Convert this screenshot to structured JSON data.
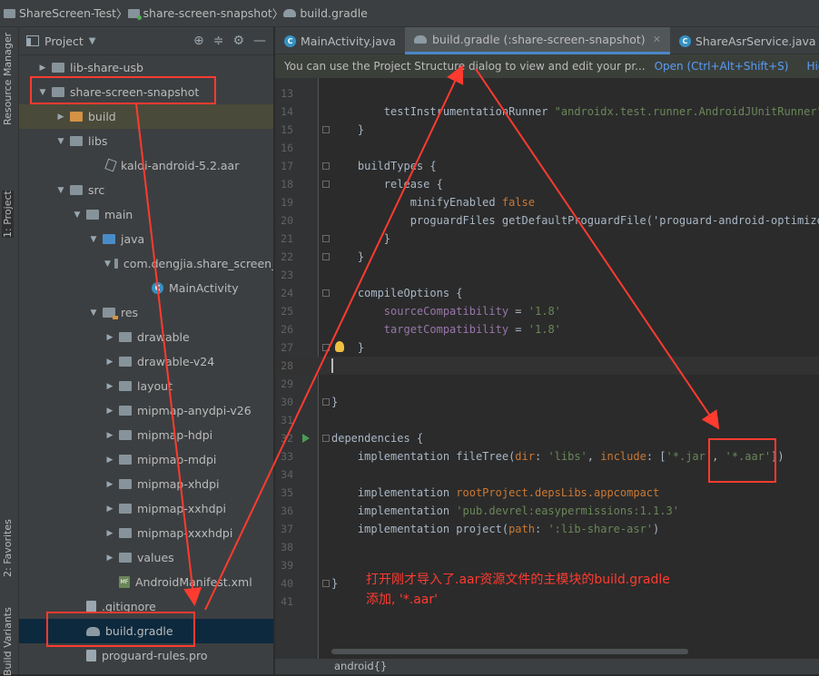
{
  "breadcrumb": [
    "ShareScreen-Test",
    "share-screen-snapshot",
    "build.gradle"
  ],
  "left_toolbar": [
    "Resource Manager",
    "1: Project",
    "2: Favorites",
    "Build Variants"
  ],
  "project_panel": {
    "title": "Project",
    "items": [
      {
        "label": "lib-share-usb",
        "expanded": false,
        "icon": "module-folder-icon"
      },
      {
        "label": "share-screen-snapshot",
        "expanded": true,
        "icon": "module-folder-icon"
      },
      {
        "label": "build",
        "expanded": false,
        "icon": "folder-orange-icon"
      },
      {
        "label": "libs",
        "expanded": true,
        "icon": "folder-icon"
      },
      {
        "label": "kaldi-android-5.2.aar",
        "icon": "aar-file-icon"
      },
      {
        "label": "src",
        "expanded": true,
        "icon": "folder-icon"
      },
      {
        "label": "main",
        "expanded": true,
        "icon": "folder-icon"
      },
      {
        "label": "java",
        "expanded": true,
        "icon": "folder-blue-icon"
      },
      {
        "label": "com.dengjia.share_screen_sn",
        "expanded": true,
        "icon": "package-icon"
      },
      {
        "label": "MainActivity",
        "icon": "class-icon"
      },
      {
        "label": "res",
        "expanded": true,
        "icon": "res-folder-icon"
      },
      {
        "label": "drawable",
        "expanded": false,
        "icon": "folder-icon"
      },
      {
        "label": "drawable-v24",
        "expanded": false,
        "icon": "folder-icon"
      },
      {
        "label": "layout",
        "expanded": false,
        "icon": "folder-icon"
      },
      {
        "label": "mipmap-anydpi-v26",
        "expanded": false,
        "icon": "folder-icon"
      },
      {
        "label": "mipmap-hdpi",
        "expanded": false,
        "icon": "folder-icon"
      },
      {
        "label": "mipmap-mdpi",
        "expanded": false,
        "icon": "folder-icon"
      },
      {
        "label": "mipmap-xhdpi",
        "expanded": false,
        "icon": "folder-icon"
      },
      {
        "label": "mipmap-xxhdpi",
        "expanded": false,
        "icon": "folder-icon"
      },
      {
        "label": "mipmap-xxxhdpi",
        "expanded": false,
        "icon": "folder-icon"
      },
      {
        "label": "values",
        "expanded": false,
        "icon": "folder-icon"
      },
      {
        "label": "AndroidManifest.xml",
        "icon": "xml-file-icon"
      },
      {
        "label": ".gitignore",
        "icon": "file-icon"
      },
      {
        "label": "build.gradle",
        "icon": "gradle-icon",
        "selected": true
      },
      {
        "label": "proguard-rules.pro",
        "icon": "file-icon"
      }
    ]
  },
  "tabs": [
    {
      "label": "MainActivity.java",
      "active": false
    },
    {
      "label": "build.gradle (:share-screen-snapshot)",
      "active": true
    },
    {
      "label": "ShareAsrService.java",
      "active": false
    }
  ],
  "notification": {
    "text": "You can use the Project Structure dialog to view and edit your pr...",
    "open_link": "Open (Ctrl+Alt+Shift+S)",
    "hide_link": "Hide notification"
  },
  "code_lines": [
    {
      "n": "13",
      "text": ""
    },
    {
      "n": "14",
      "text": "        testInstrumentationRunner \"androidx.test.runner.AndroidJUnitRunner\""
    },
    {
      "n": "15",
      "text": "    }"
    },
    {
      "n": "16",
      "text": ""
    },
    {
      "n": "17",
      "text": "    buildTypes {"
    },
    {
      "n": "18",
      "text": "        release {"
    },
    {
      "n": "19",
      "text": "            minifyEnabled false"
    },
    {
      "n": "20",
      "text": "            proguardFiles getDefaultProguardFile('proguard-android-optimize.t"
    },
    {
      "n": "21",
      "text": "        }"
    },
    {
      "n": "22",
      "text": "    }"
    },
    {
      "n": "23",
      "text": ""
    },
    {
      "n": "24",
      "text": "    compileOptions {"
    },
    {
      "n": "25",
      "text": "        sourceCompatibility = '1.8'"
    },
    {
      "n": "26",
      "text": "        targetCompatibility = '1.8'"
    },
    {
      "n": "27",
      "text": "    }"
    },
    {
      "n": "28",
      "text": ""
    },
    {
      "n": "29",
      "text": ""
    },
    {
      "n": "30",
      "text": "}"
    },
    {
      "n": "31",
      "text": ""
    },
    {
      "n": "32",
      "text": "dependencies {"
    },
    {
      "n": "33",
      "text": "    implementation fileTree(dir: 'libs', include: ['*.jar', '*.aar'])"
    },
    {
      "n": "34",
      "text": ""
    },
    {
      "n": "35",
      "text": "    implementation rootProject.depsLibs.appcompact"
    },
    {
      "n": "36",
      "text": "    implementation 'pub.devrel:easypermissions:1.1.3'"
    },
    {
      "n": "37",
      "text": "    implementation project(path: ':lib-share-asr')"
    },
    {
      "n": "38",
      "text": ""
    },
    {
      "n": "39",
      "text": ""
    },
    {
      "n": "40",
      "text": "}"
    },
    {
      "n": "41",
      "text": ""
    }
  ],
  "annotation": {
    "line1": "打开刚才导入了.aar资源文件的主模块的build.gradle",
    "line2": "添加, '*.aar'"
  },
  "status": {
    "context": "android{}"
  },
  "colors": {
    "annotation": "#ff3b30",
    "link": "#589df6",
    "active_tab_underline": "#4a88c7"
  }
}
